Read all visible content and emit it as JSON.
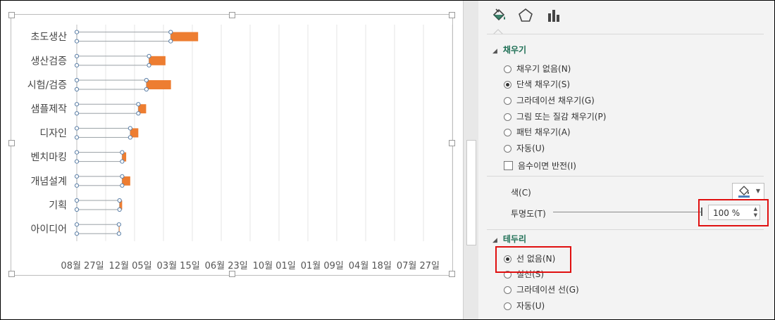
{
  "chart_data": {
    "type": "bar",
    "stacked": true,
    "orientation": "horizontal",
    "categories": [
      "초도생산",
      "생산검증",
      "시험/검증",
      "샘플제작",
      "디자인",
      "벤치마킹",
      "개념설계",
      "기획",
      "아이디어"
    ],
    "x_tick_labels": [
      "08월 27일",
      "12월 05일",
      "03월 15일",
      "06월 23일",
      "10월 01일",
      "01월 09일",
      "04월 18일",
      "07월 27일"
    ],
    "series": [
      {
        "role": "start (no fill, selected)",
        "values_days": [
          325,
          250,
          241,
          213,
          185,
          157,
          157,
          148,
          146
        ],
        "color": "#ffffff"
      },
      {
        "role": "duration",
        "values_days": [
          95,
          57,
          85,
          27,
          28,
          14,
          28,
          9,
          2
        ],
        "color": "#ED7D31"
      }
    ],
    "grid": true,
    "legend": "none"
  },
  "pane": {
    "tabs": [
      {
        "name": "fill-line",
        "icon": "paint-bucket-icon"
      },
      {
        "name": "effects",
        "icon": "pentagon-icon"
      },
      {
        "name": "series-options",
        "icon": "bar-chart-icon"
      }
    ],
    "fill": {
      "title": "채우기",
      "options": [
        "채우기 없음(N)",
        "단색 채우기(S)",
        "그라데이션 채우기(G)",
        "그림 또는 질감 채우기(P)",
        "패턴 채우기(A)",
        "자동(U)"
      ],
      "selected_index": 1,
      "invert_label": "음수이면 반전(I)",
      "color_label": "색(C)",
      "transparency_label": "투명도(T)",
      "transparency_value": "100 %"
    },
    "border": {
      "title": "테두리",
      "options": [
        "선 없음(N)",
        "실선(S)",
        "그라데이션 선(G)",
        "자동(U)"
      ],
      "selected_index": 0
    }
  },
  "colors": {
    "accent_green": "#1e6f55",
    "bar_orange": "#ED7D31",
    "highlight_red": "#e01010"
  }
}
